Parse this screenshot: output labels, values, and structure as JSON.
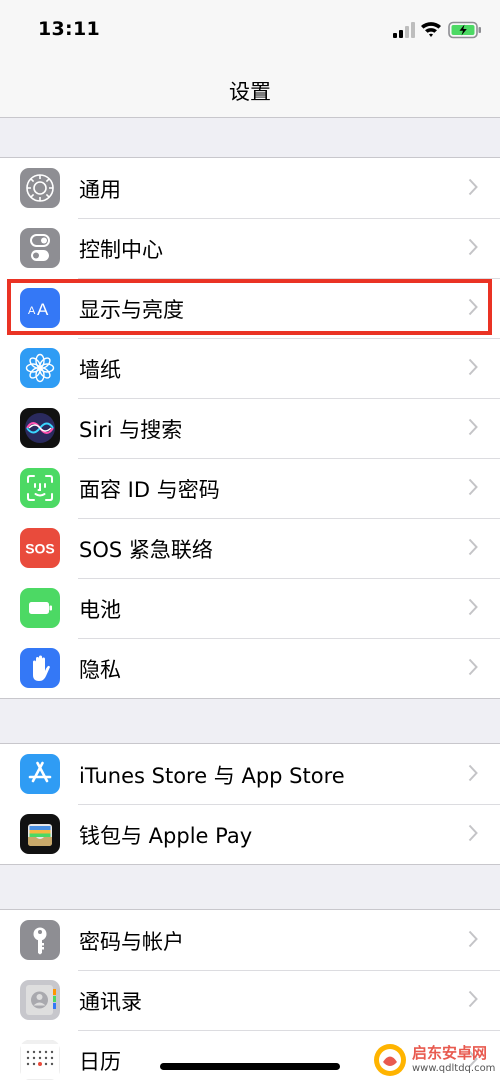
{
  "status_bar": {
    "time": "13:11"
  },
  "nav": {
    "title": "设置"
  },
  "groups": [
    {
      "items": [
        {
          "label": "通用"
        },
        {
          "label": "控制中心"
        },
        {
          "label": "显示与亮度"
        },
        {
          "label": "墙纸"
        },
        {
          "label": "Siri 与搜索"
        },
        {
          "label": "面容 ID 与密码"
        },
        {
          "label": "SOS 紧急联络",
          "icon_text": "SOS"
        },
        {
          "label": "电池"
        },
        {
          "label": "隐私"
        }
      ]
    },
    {
      "items": [
        {
          "label": "iTunes Store 与 App Store"
        },
        {
          "label": "钱包与 Apple Pay"
        }
      ]
    },
    {
      "items": [
        {
          "label": "密码与帐户"
        },
        {
          "label": "通讯录"
        },
        {
          "label": "日历"
        }
      ]
    }
  ],
  "watermark": {
    "name": "启东安卓网",
    "url": "www.qdltdq.com"
  },
  "colors": {
    "background": "#efeff4",
    "highlight_border": "#ea3324",
    "icon_gray": "#8e8e93",
    "icon_blue": "#3478f6",
    "icon_sky": "#2f9cf4",
    "icon_green": "#4cd964",
    "icon_red": "#e94b3c"
  },
  "highlighted_item": "显示与亮度"
}
